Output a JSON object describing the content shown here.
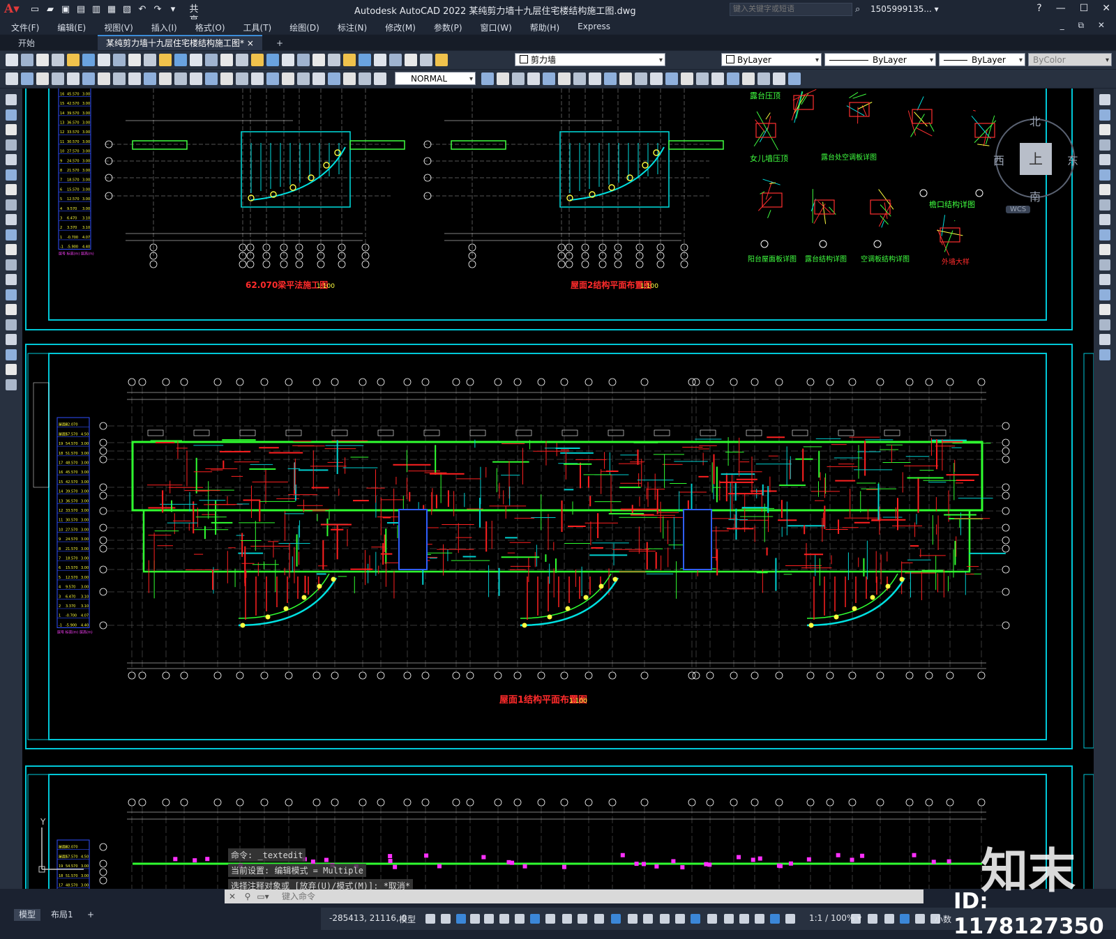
{
  "app": {
    "title": "Autodesk AutoCAD 2022    某纯剪力墙十九层住宅楼结构施工图.dwg",
    "share": "共享",
    "search_placeholder": "键入关键字或短语",
    "user": "1505999135... ▾"
  },
  "menu": [
    "文件(F)",
    "编辑(E)",
    "视图(V)",
    "插入(I)",
    "格式(O)",
    "工具(T)",
    "绘图(D)",
    "标注(N)",
    "修改(M)",
    "参数(P)",
    "窗口(W)",
    "帮助(H)",
    "Express"
  ],
  "tabs": {
    "start": "开始",
    "drawing": "某纯剪力墙十九层住宅楼结构施工图*",
    "close": "×",
    "add": "+"
  },
  "toolbar": {
    "layer": "剪力墙",
    "color": "ByLayer",
    "linetype": "ByLayer",
    "lineweight": "ByLayer",
    "plotstyle": "ByColor",
    "textstyle": "NORMAL"
  },
  "viewcube": {
    "north": "北",
    "south": "南",
    "east": "东",
    "west": "西",
    "top": "上",
    "wcs": "WCS"
  },
  "drawing_titles": {
    "plan_a": "62.070梁平法施工图",
    "plan_a_scale": "1:100",
    "plan_b": "屋面2结构平面布置图",
    "plan_b_scale": "1:100",
    "plan_main": "屋面1结构平面布置图",
    "plan_main_scale": "1:100",
    "d1": "露台压顶",
    "d2": "女儿墙压顶",
    "d3": "露台处空调板详图",
    "d4": "檐口结构详图",
    "d5": "阳台屋面板详图",
    "d6": "露台结构详图",
    "d7": "空调板结构详图",
    "d8": "外墙大样"
  },
  "level_table": {
    "rows": [
      [
        "屋面2",
        "62.070",
        ""
      ],
      [
        "屋面1",
        "57.570",
        "4.50"
      ],
      [
        "19",
        "54.570",
        "3.00"
      ],
      [
        "18",
        "51.570",
        "3.00"
      ],
      [
        "17",
        "48.570",
        "3.00"
      ],
      [
        "16",
        "45.570",
        "3.00"
      ],
      [
        "15",
        "42.570",
        "3.00"
      ],
      [
        "14",
        "39.570",
        "3.00"
      ],
      [
        "13",
        "36.570",
        "3.00"
      ],
      [
        "12",
        "33.570",
        "3.00"
      ],
      [
        "11",
        "30.570",
        "3.00"
      ],
      [
        "10",
        "27.570",
        "3.00"
      ],
      [
        "9",
        "24.570",
        "3.00"
      ],
      [
        "8",
        "21.570",
        "3.00"
      ],
      [
        "7",
        "18.570",
        "3.00"
      ],
      [
        "6",
        "15.570",
        "3.00"
      ],
      [
        "5",
        "12.570",
        "3.00"
      ],
      [
        "4",
        "9.570",
        "3.00"
      ],
      [
        "3",
        "6.470",
        "3.10"
      ],
      [
        "2",
        "3.370",
        "3.10"
      ],
      [
        "1",
        "-0.700",
        "4.07"
      ],
      [
        "-1",
        "-5.900",
        "4.40"
      ]
    ],
    "footer": "层号  标高(m)  层高(m)"
  },
  "command": {
    "history": [
      "命令: _textedit",
      "当前设置: 编辑模式 = Multiple",
      "选择注释对象或 [放弃(U)/模式(M)]: *取消*"
    ],
    "placeholder": "键入命令"
  },
  "layout_tabs": [
    "模型",
    "布局1",
    "+"
  ],
  "status": {
    "coords": "-285413, 21116, 0",
    "model": "模型",
    "scale": "1:1 / 100% ▾",
    "units": "小数"
  },
  "watermark": {
    "logo": "知末",
    "id": "ID: 1178127350"
  }
}
